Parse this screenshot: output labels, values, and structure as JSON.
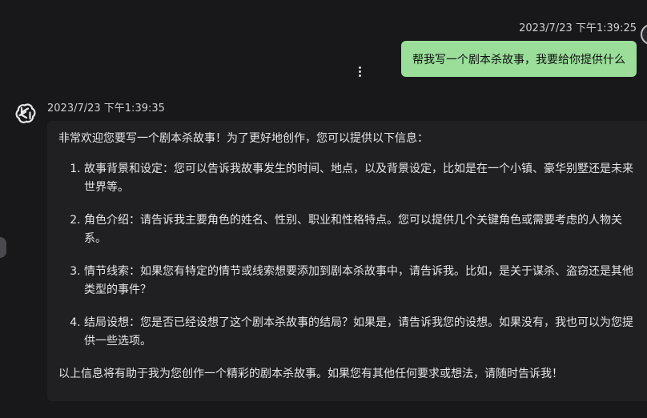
{
  "user_message": {
    "timestamp": "2023/7/23 下午1:39:25",
    "text": "帮我写一个剧本杀故事，我要给你提供什么"
  },
  "assistant_message": {
    "timestamp": "2023/7/23 下午1:39:35",
    "intro": "非常欢迎您要写一个剧本杀故事！为了更好地创作，您可以提供以下信息：",
    "items": [
      "故事背景和设定：您可以告诉我故事发生的时间、地点，以及背景设定，比如是在一个小镇、豪华别墅还是未来世界等。",
      "角色介绍：请告诉我主要角色的姓名、性别、职业和性格特点。您可以提供几个关键角色或需要考虑的人物关系。",
      "情节线索：如果您有特定的情节或线索想要添加到剧本杀故事中，请告诉我。比如，是关于谋杀、盗窃还是其他类型的事件？",
      "结局设想：您是否已经设想了这个剧本杀故事的结局？如果是，请告诉我您的设想。如果没有，我也可以为您提供一些选项。"
    ],
    "outro": "以上信息将有助于我为您创作一个精彩的剧本杀故事。如果您有其他任何要求或想法，请随时告诉我！"
  },
  "icons": {
    "assistant_avatar": "openai-logo-icon",
    "message_menu": "more-vertical-icon"
  }
}
